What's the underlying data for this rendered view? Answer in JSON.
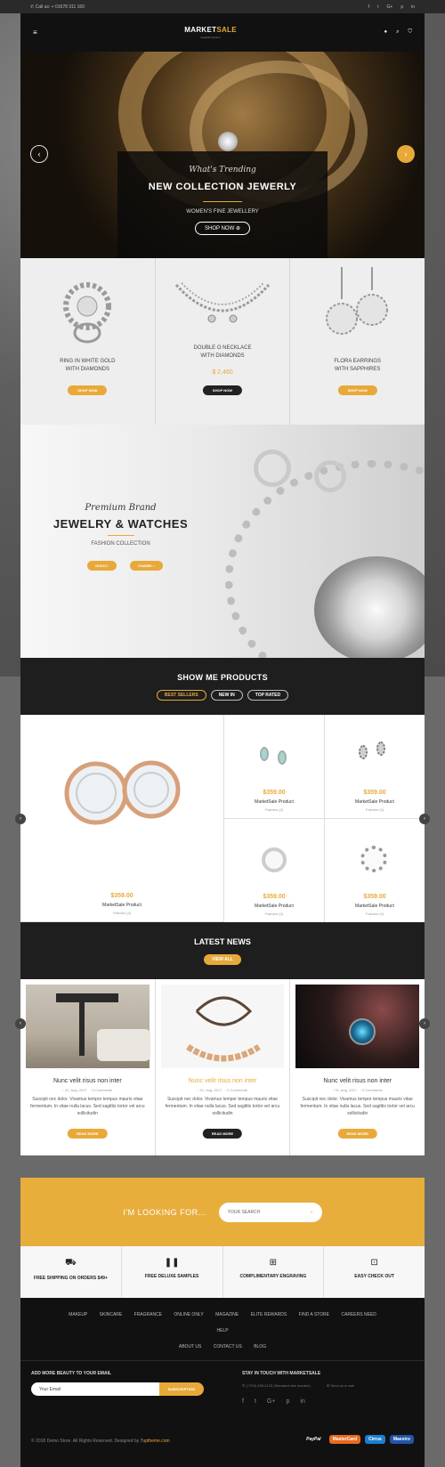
{
  "topbar": {
    "call_label": "Call us:",
    "phone": "+ 01678 311 160",
    "social_icons": [
      "facebook-icon",
      "twitter-icon",
      "google-plus-icon",
      "pinterest-icon",
      "linkedin-icon"
    ]
  },
  "header": {
    "brand_part1": "MARKET",
    "brand_part2": "SALE",
    "tagline": "beautiful fashion"
  },
  "hero": {
    "script": "What's Trending",
    "title": "NEW COLLECTION JEWERLY",
    "subtitle": "WOMEN'S FINE JEWELLERY",
    "button": "SHOP NOW"
  },
  "featured": [
    {
      "name_line1": "RING IN WHITE GOLD",
      "name_line2": "WITH DIAMONDS",
      "price": "",
      "button": "SHOP NOW"
    },
    {
      "name_line1": "DOUBLE O NECKLACE",
      "name_line2": "WITH DIAMONDS",
      "price": "$ 2,460",
      "button": "SHOP NOW"
    },
    {
      "name_line1": "FLORA EARRINGS",
      "name_line2": "WITH SAPPHIRES",
      "price": "",
      "button": "SHOP NOW"
    }
  ],
  "banner": {
    "script": "Premium Brand",
    "title": "JEWELRY & WATCHES",
    "subtitle": "FASHION COLLECTION",
    "button1": "GUCCI",
    "button2": "CHANEL"
  },
  "showme": {
    "title": "SHOW ME PRODUCTS",
    "tabs": [
      "BEST SELLERS",
      "NEW IN",
      "TOP RATED"
    ]
  },
  "products": [
    {
      "price": "$359.00",
      "name": "MarketSale Product",
      "category": "Fashion (4)"
    },
    {
      "price": "$359.00",
      "name": "MarketSale Product",
      "category": "Fashion (4)"
    },
    {
      "price": "$359.00",
      "name": "MarketSale Product",
      "category": "Fashion (4)"
    },
    {
      "price": "$359.00",
      "name": "MarketSale Product",
      "category": "Fashion (4)"
    },
    {
      "price": "$359.00",
      "name": "MarketSale Product",
      "category": "Fashion (4)"
    }
  ],
  "news": {
    "title": "LATEST NEWS",
    "view_all": "VIEW ALL",
    "posts": [
      {
        "title": "Nunc velit risus non inter",
        "date": "31, Aug, 2017",
        "comments": "0 Comments",
        "excerpt": "Suscipit nec dolor. Vivamus tempor tempus mauris vitae fermentum. In vitae nulla lacus. Sed sagittis tortor vel arcu sollicitudin",
        "button": "READ MORE"
      },
      {
        "title": "Nunc velit risus non inter",
        "date": "31, Aug, 2017",
        "comments": "0 Comments",
        "excerpt": "Suscipit nec dolor. Vivamus tempor tempus mauris vitae fermentum. In vitae nulla lacus. Sed sagittis tortor vel arcu sollicitudin",
        "button": "READ MORE"
      },
      {
        "title": "Nunc velit risus non inter",
        "date": "31, Aug, 2017",
        "comments": "0 Comments",
        "excerpt": "Suscipit nec dolor. Vivamus tempor tempus mauris vitae fermentum. In vitae nulla lacus. Sed sagittis tortor vel arcu sollicitudin",
        "button": "READ MORE"
      }
    ]
  },
  "search": {
    "label": "I'M LOOKING FOR...",
    "placeholder": "YOUR SEARCH"
  },
  "features": [
    {
      "icon": "truck-icon",
      "label": "FREE SHIPPING ON ORDERS $49+"
    },
    {
      "icon": "bottles-icon",
      "label": "FREE DELUXE SAMPLES"
    },
    {
      "icon": "gift-icon",
      "label": "COMPLIMENTARY ENGRAVING"
    },
    {
      "icon": "lock-icon",
      "label": "EASY CHECK OUT"
    }
  ],
  "footer": {
    "nav_row1": [
      "MAKEUP",
      "SKINCARE",
      "FRAGRANCE",
      "ONLINE ONLY",
      "MAGAZINE",
      "ELITE REWARDS",
      "FIND A STORE",
      "CAREERS NEED",
      "HELP"
    ],
    "nav_row2": [
      "ABOUT US",
      "CONTACT US",
      "BLOG"
    ],
    "newsletter_title": "ADD MORE BEAUTY TO YOUR EMAIL",
    "email_placeholder": "Your Email",
    "subscribe": "SUBSCRIPTION",
    "touch_title": "STAY IN TOUCH WITH MARKETSALE",
    "phone_note": "(+700) 455-2120 (Standard rate number)",
    "mail_note": "Send us a mail",
    "copyright": "© 2018 Demo Store. All Rights Reserved. Designed by",
    "designer": "7uptheme.com",
    "payments": [
      "PayPal",
      "MasterCard",
      "Cirrus",
      "Maestro"
    ]
  },
  "colors": {
    "accent": "#e8a93a",
    "dark": "#1e1e1e"
  }
}
